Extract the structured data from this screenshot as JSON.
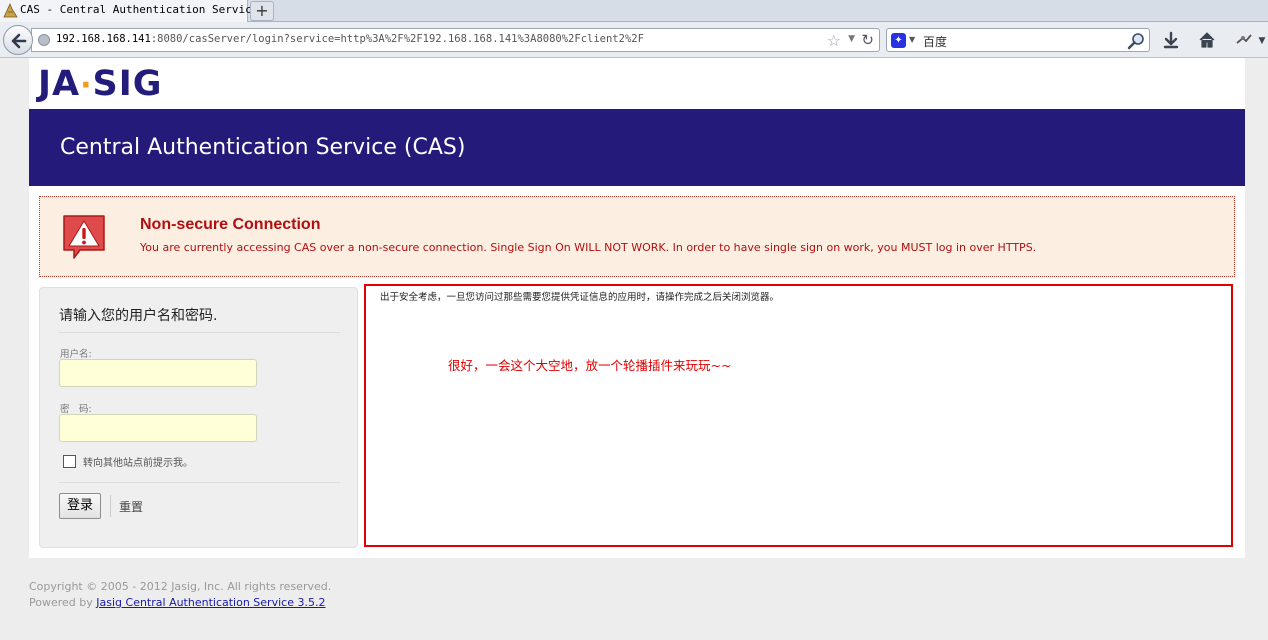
{
  "browser": {
    "tab_title": "CAS - Central Authentication Service",
    "new_tab_symbol": "+",
    "url_host": "192.168.168.141",
    "url_rest": ":8080/casServer/login?service=http%3A%2F%2F192.168.168.141%3A8080%2Fclient2%2F",
    "search_engine": "百度",
    "icons": [
      "back-arrow-icon",
      "globe-icon",
      "bookmark-star-icon",
      "history-dropdown-icon",
      "reload-icon",
      "baidu-engine-icon",
      "search-magnifier-icon",
      "download-icon",
      "home-icon",
      "addon-icon"
    ]
  },
  "header": {
    "logo_left": "JA",
    "logo_dot": "·",
    "logo_right": "SIG",
    "banner_title": "Central Authentication Service (CAS)"
  },
  "warning": {
    "title": "Non-secure Connection",
    "message": "You are currently accessing CAS over a non-secure connection. Single Sign On WILL NOT WORK. In order to have single sign on work, you MUST log in over HTTPS.",
    "icon": "warning-triangle-icon"
  },
  "login": {
    "heading": "请输入您的用户名和密码.",
    "username_label": "用户名:",
    "username_value": "",
    "password_label": "密　码:",
    "password_value": "",
    "warn_label": "转向其他站点前提示我。",
    "warn_checked": false,
    "submit_label": "登录",
    "reset_label": "重置"
  },
  "info": {
    "notice": "出于安全考虑，一旦您访问过那些需要您提供凭证信息的应用时，请操作完成之后关闭浏览器。",
    "remark": "很好，一会这个大空地，放一个轮播插件来玩玩~~"
  },
  "footer": {
    "copyright": "Copyright © 2005 - 2012 Jasig, Inc. All rights reserved.",
    "powered_prefix": "Powered by ",
    "powered_link": "Jasig Central Authentication Service 3.5.2"
  },
  "colors": {
    "banner": "#231a79",
    "logo_accent": "#f59b1c",
    "warning_text": "#b01010",
    "warning_bg": "#fdeee2",
    "highlight_border": "#e00000",
    "input_bg": "#ffffd8"
  }
}
